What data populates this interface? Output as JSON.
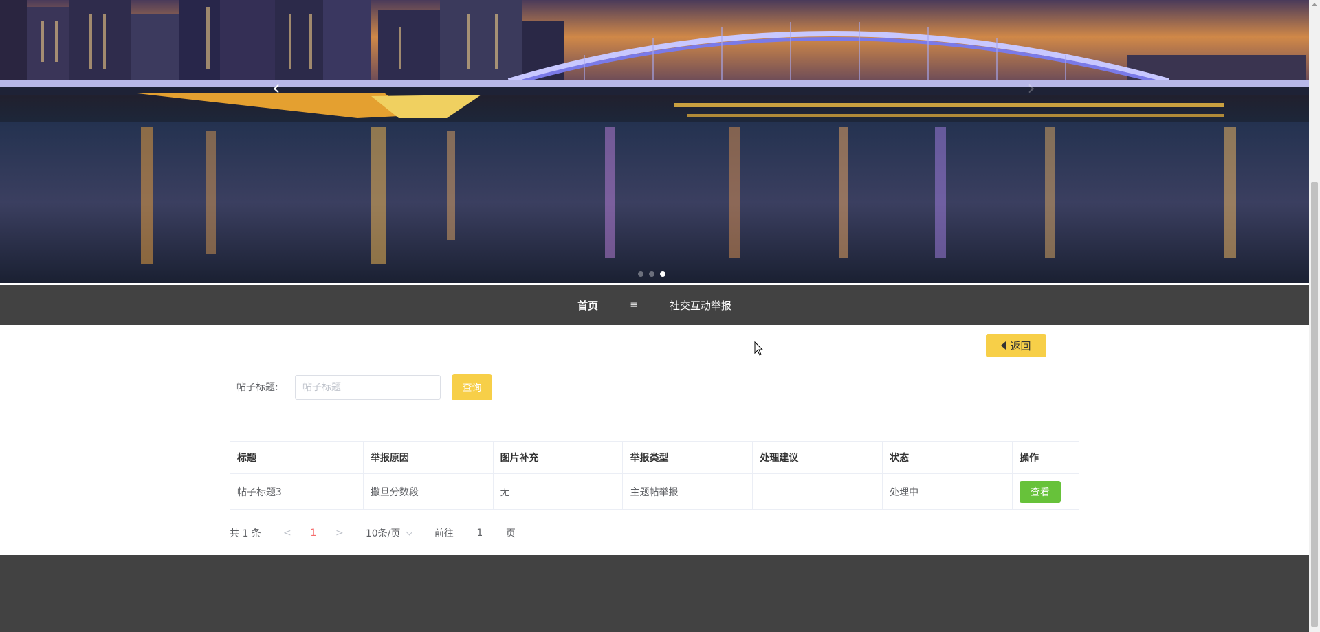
{
  "carousel": {
    "prev_arrow": "‹",
    "next_arrow": "›",
    "indicators": [
      false,
      false,
      true
    ]
  },
  "nav": {
    "home": "首页",
    "separator": "≡",
    "current": "社交互动举报"
  },
  "back_button": {
    "label": "返回"
  },
  "search": {
    "label": "帖子标题:",
    "placeholder": "帖子标题",
    "button_label": "查询"
  },
  "table": {
    "columns": [
      "标题",
      "举报原因",
      "图片补充",
      "举报类型",
      "处理建议",
      "状态",
      "操作"
    ],
    "rows": [
      {
        "title": "帖子标题3",
        "reason": "撒旦分数段",
        "image": "无",
        "type": "主题帖举报",
        "suggestion": "",
        "status": "处理中",
        "action": "查看"
      }
    ]
  },
  "pagination": {
    "total": "共 1 条",
    "prev": "<",
    "current_page": "1",
    "next": ">",
    "page_size": "10条/页",
    "goto_prefix": "前往",
    "goto_value": "1",
    "goto_suffix": "页"
  },
  "colors": {
    "accent_yellow": "#f7cf48",
    "nav_bg": "#424242",
    "view_button": "#67c23a",
    "active_page": "#f56c6c"
  }
}
